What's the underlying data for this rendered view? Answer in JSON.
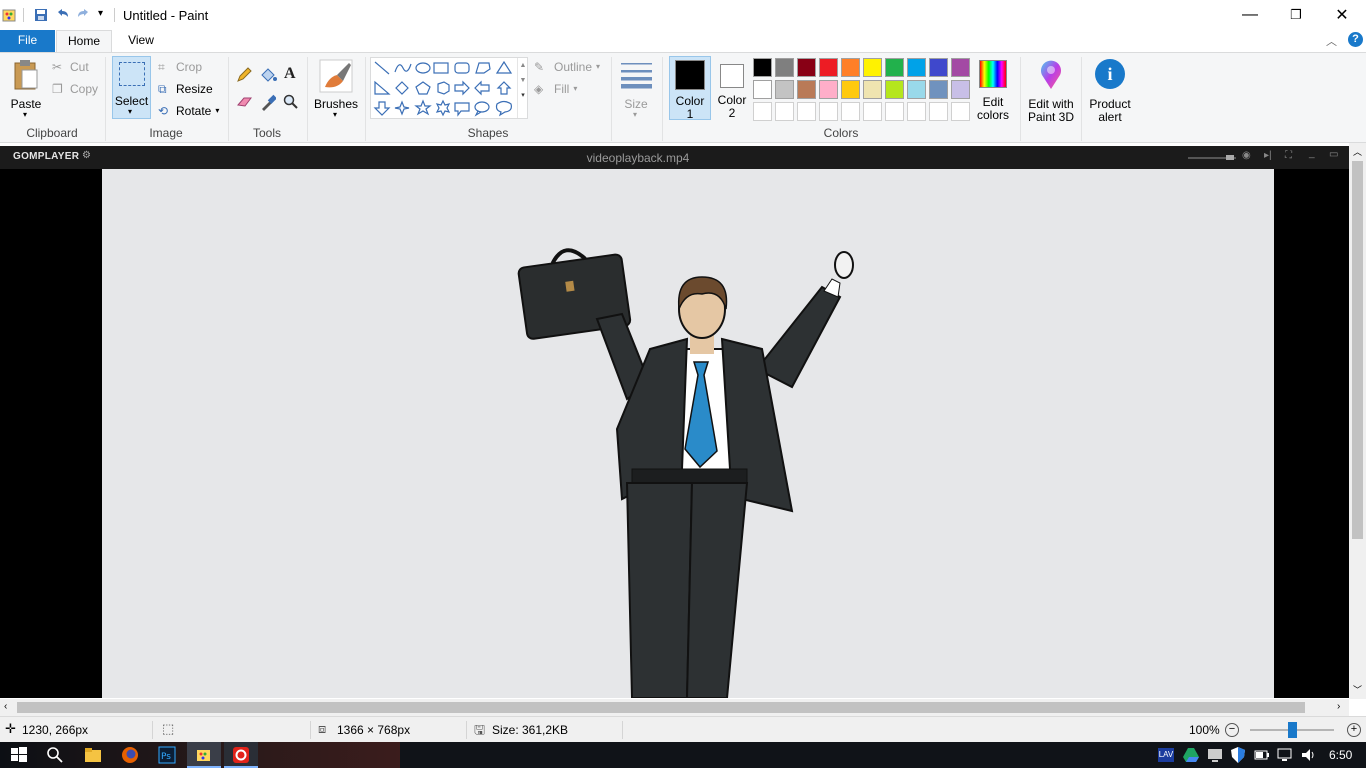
{
  "window": {
    "title": "Untitled - Paint"
  },
  "tabs": [
    {
      "label": "File"
    },
    {
      "label": "Home"
    },
    {
      "label": "View"
    }
  ],
  "ribbon": {
    "clipboard": {
      "paste": "Paste",
      "cut": "Cut",
      "copy": "Copy",
      "label": "Clipboard"
    },
    "image": {
      "select": "Select",
      "crop": "Crop",
      "resize": "Resize",
      "rotate": "Rotate",
      "label": "Image"
    },
    "tools": {
      "label": "Tools"
    },
    "brushes": {
      "label": "Brushes"
    },
    "shapes": {
      "outline": "Outline",
      "fill": "Fill",
      "label": "Shapes"
    },
    "size": {
      "label": "Size"
    },
    "colors": {
      "color1": "Color\n1",
      "color1_a": "Color",
      "color1_b": "1",
      "color2_a": "Color",
      "color2_b": "2",
      "edit_a": "Edit",
      "edit_b": "colors",
      "label": "Colors",
      "row1": [
        "#000000",
        "#7f7f7f",
        "#880015",
        "#ed1c24",
        "#ff7f27",
        "#fff200",
        "#22b14c",
        "#00a2e8",
        "#3f48cc",
        "#a349a4"
      ],
      "row2": [
        "#ffffff",
        "#c3c3c3",
        "#b97a57",
        "#ffaec9",
        "#ffc90e",
        "#efe4b0",
        "#b5e61d",
        "#99d9ea",
        "#7092be",
        "#c8bfe7"
      ]
    },
    "paint3d": {
      "a": "Edit with",
      "b": "Paint 3D"
    },
    "alert": {
      "a": "Product",
      "b": "alert"
    }
  },
  "gom": {
    "logo": "GOMPLAYER",
    "file": "videoplayback.mp4"
  },
  "status": {
    "cursor": "1230, 266px",
    "dimensions": "1366 × 768px",
    "size": "Size: 361,2KB",
    "zoom": "100%",
    "zoom_level": 0.5
  },
  "taskbar": {
    "time": "6:50"
  }
}
